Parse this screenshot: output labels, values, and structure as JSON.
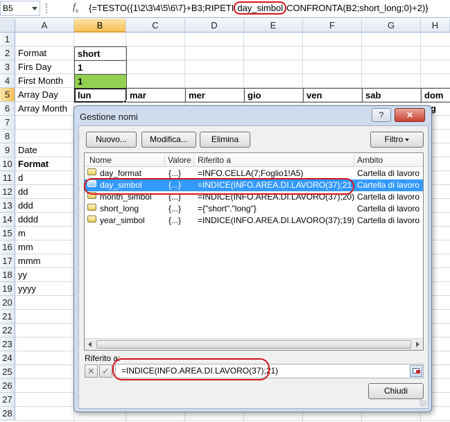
{
  "formula_bar": {
    "cell_ref": "B5",
    "fx": "fx",
    "formula_before": "{=TESTO({1\\2\\3\\4\\5\\6\\7}+B3;RIPETI",
    "formula_highlight": "day_simbol",
    "formula_after": "CONFRONTA(B2;short_long;0)+2)}"
  },
  "sheet": {
    "columns": [
      "A",
      "B",
      "C",
      "D",
      "E",
      "F",
      "G",
      "H"
    ],
    "selected_column": "B",
    "rows": [
      "1",
      "2",
      "3",
      "4",
      "5",
      "6",
      "7",
      "8",
      "9",
      "10",
      "11",
      "12",
      "13",
      "14",
      "15",
      "16",
      "17",
      "18",
      "19",
      "20",
      "21",
      "22",
      "23",
      "24",
      "25",
      "26",
      "27",
      "28"
    ],
    "selected_row": "5",
    "col_a": {
      "2": "Format",
      "3": "Firs Day",
      "4": "First Month",
      "5": "Array Day",
      "6": "Array Month",
      "9": "Date",
      "10": "Format",
      "11": "d",
      "12": "dd",
      "13": "ddd",
      "14": "dddd",
      "15": "m",
      "16": "mm",
      "17": "mmm",
      "18": "yy",
      "19": "yyyy"
    },
    "col_b": {
      "2": "short",
      "3": "1",
      "4": "1"
    },
    "row5": [
      "lun",
      "mar",
      "mer",
      "gio",
      "ven",
      "sab",
      "dom"
    ],
    "row6_h": "g",
    "fill_color_green": "#92d050"
  },
  "dialog": {
    "title": "Gestione nomi",
    "help_button": "?",
    "close_button": "✕",
    "buttons": {
      "nuovo": "Nuovo...",
      "modifica": "Modifica...",
      "elimina": "Elimina",
      "filtro": "Filtro"
    },
    "columns": [
      "Nome",
      "Valore",
      "Riferito a",
      "Ambito"
    ],
    "rows": [
      {
        "name": "day_format",
        "value": "{...}",
        "ref": "=INFO.CELLA(7;Foglio1!A5)",
        "scope": "Cartella di lavoro"
      },
      {
        "name": "day_simbol",
        "value": "{...}",
        "ref": "=INDICE(INFO.AREA.DI.LAVORO(37);21)",
        "scope": "Cartella di lavoro"
      },
      {
        "name": "month_simbol",
        "value": "{...}",
        "ref": "=INDICE(INFO.AREA.DI.LAVORO(37);20)",
        "scope": "Cartella di lavoro"
      },
      {
        "name": "short_long",
        "value": "{...}",
        "ref": "={\"short\".\"long\"}",
        "scope": "Cartella di lavoro"
      },
      {
        "name": "year_simbol",
        "value": "{...}",
        "ref": "=INDICE(INFO.AREA.DI.LAVORO(37);19)",
        "scope": "Cartella di lavoro"
      }
    ],
    "selected_row_index": 1,
    "ref_label": "Riferito a:",
    "ref_value": "=INDICE(INFO.AREA.DI.LAVORO(37);21)",
    "cancel_icon": "✕",
    "confirm_icon": "✓",
    "chiudi": "Chiudi",
    "highlight_color": "#3399ff",
    "annotation_color": "#d4161b"
  }
}
